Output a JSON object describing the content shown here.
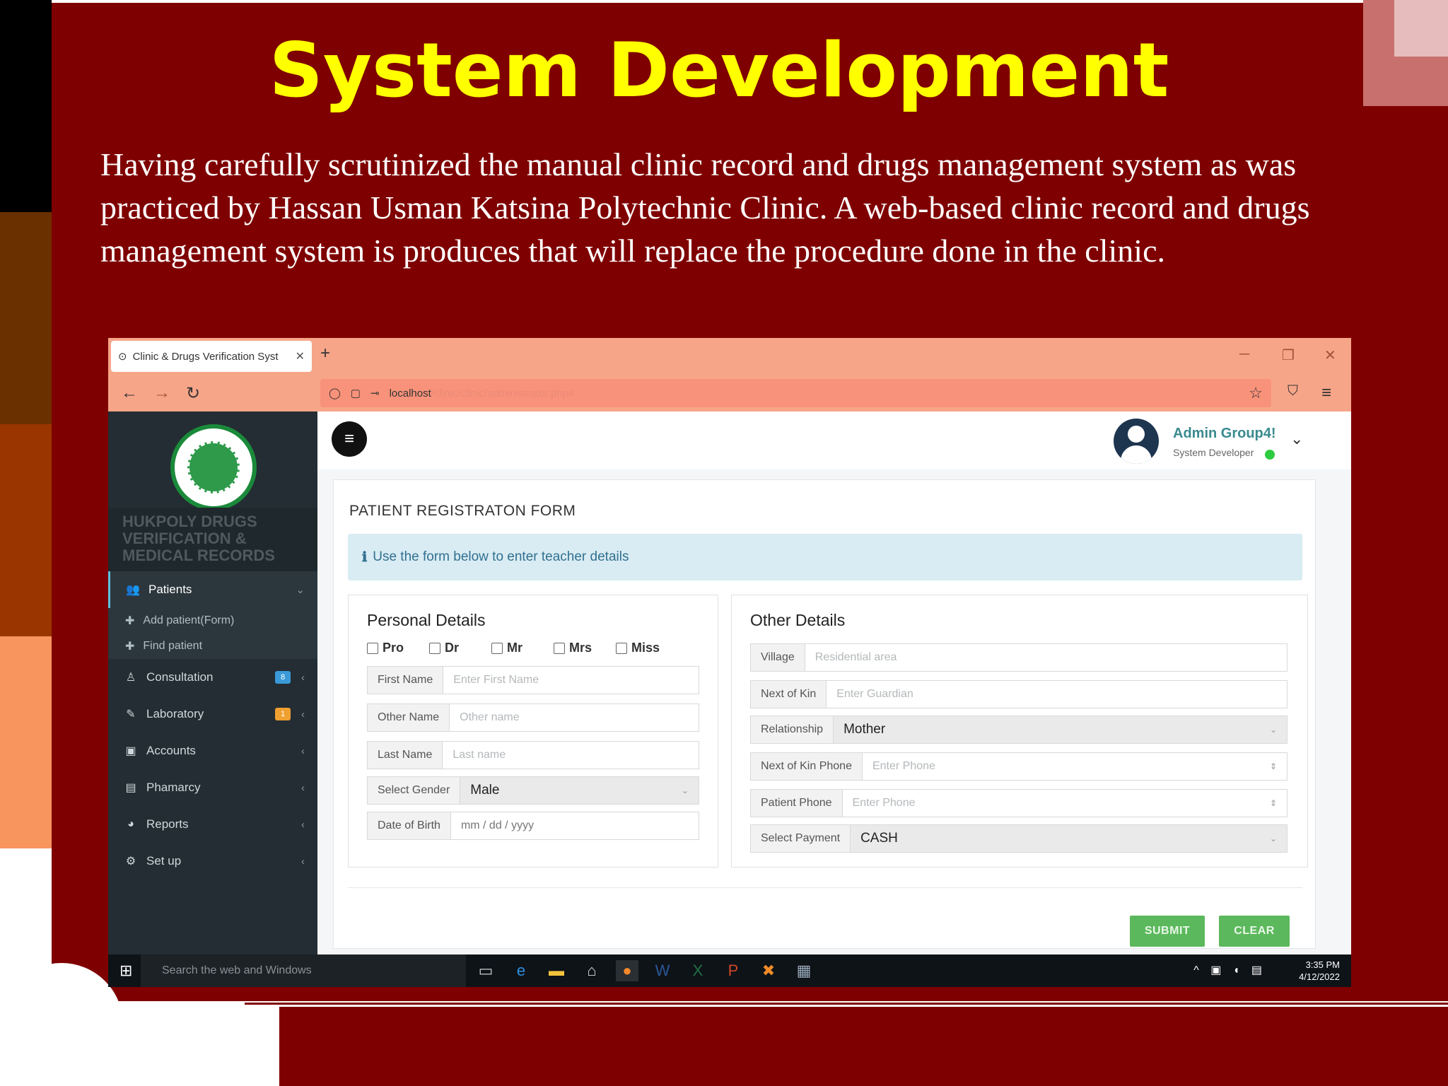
{
  "slide": {
    "title": "System Development",
    "body": "Having carefully scrutinized the manual clinic record and drugs management system as was practiced by Hassan Usman Katsina Polytechnic Clinic. A web-based clinic record and drugs management system is produces that will replace the procedure done in the clinic.",
    "colors": {
      "background": "#7f0000",
      "title": "#ffff00",
      "text": "#ffffff"
    }
  },
  "browser": {
    "tab_title": "Clinic & Drugs Verification Syst",
    "url_host": "localhost",
    "url_path": "/clinic/clinic/administrator.php#"
  },
  "sidebar": {
    "brand": "HUKPOLY DRUGS VERIFICATION & MEDICAL RECORDS",
    "items": [
      {
        "label": "Patients",
        "icon": "users-icon"
      },
      {
        "label": "Consultation",
        "icon": "user-md-icon",
        "badge": "8"
      },
      {
        "label": "Laboratory",
        "icon": "syringe-icon",
        "badge": "1"
      },
      {
        "label": "Accounts",
        "icon": "money-icon"
      },
      {
        "label": "Phamarcy",
        "icon": "briefcase-icon"
      },
      {
        "label": "Reports",
        "icon": "pie-chart-icon"
      },
      {
        "label": "Set up",
        "icon": "cogs-icon"
      }
    ],
    "subitems": [
      {
        "label": "Add patient(Form)"
      },
      {
        "label": "Find patient"
      }
    ]
  },
  "header": {
    "user_name": "Admin Group4!",
    "user_role": "System Developer"
  },
  "form": {
    "title": "PATIENT REGISTRATON FORM",
    "info": "Use the form below to enter teacher details",
    "personal": {
      "title": "Personal Details",
      "titles": [
        "Pro",
        "Dr",
        "Mr",
        "Mrs",
        "Miss"
      ],
      "first_name": {
        "label": "First Name",
        "placeholder": "Enter First Name"
      },
      "other_name": {
        "label": "Other Name",
        "placeholder": "Other name"
      },
      "last_name": {
        "label": "Last Name",
        "placeholder": "Last name"
      },
      "gender": {
        "label": "Select Gender",
        "value": "Male"
      },
      "dob": {
        "label": "Date of Birth",
        "placeholder": "mm / dd / yyyy"
      }
    },
    "other": {
      "title": "Other Details",
      "village": {
        "label": "Village",
        "placeholder": "Residential area"
      },
      "next_of_kin": {
        "label": "Next of Kin",
        "placeholder": "Enter Guardian"
      },
      "relationship": {
        "label": "Relationship",
        "value": "Mother"
      },
      "kin_phone": {
        "label": "Next of Kin Phone",
        "placeholder": "Enter Phone"
      },
      "patient_phone": {
        "label": "Patient Phone",
        "placeholder": "Enter Phone"
      },
      "payment": {
        "label": "Select Payment",
        "value": "CASH"
      }
    },
    "submit_label": "SUBMIT",
    "clear_label": "CLEAR"
  },
  "taskbar": {
    "search_placeholder": "Search the web and Windows",
    "time": "3:35 PM",
    "date": "4/12/2022"
  }
}
